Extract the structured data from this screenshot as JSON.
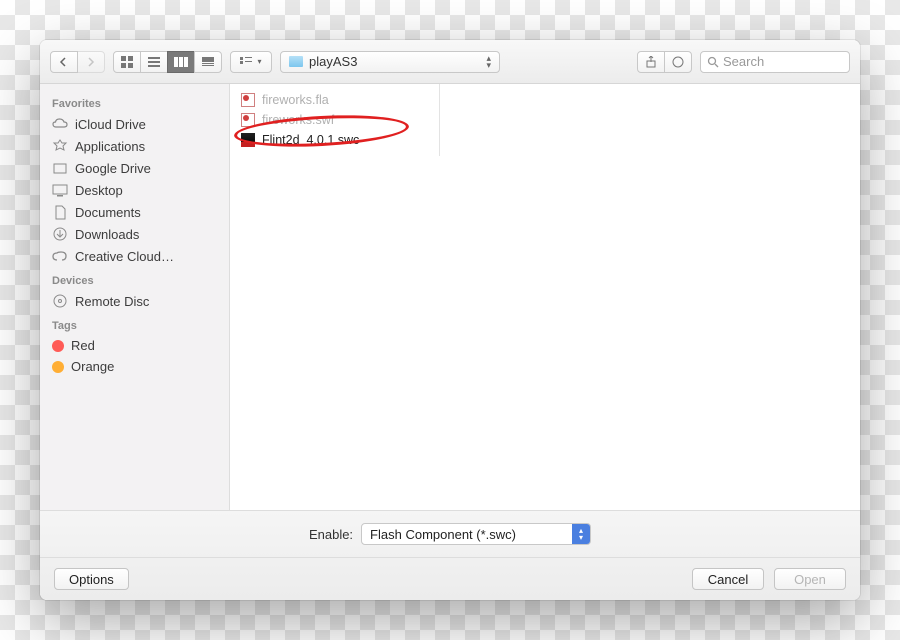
{
  "toolbar": {
    "path_label": "playAS3",
    "search_placeholder": "Search"
  },
  "sidebar": {
    "sections": [
      {
        "header": "Favorites",
        "items": [
          {
            "label": "iCloud Drive",
            "icon": "cloud-icon"
          },
          {
            "label": "Applications",
            "icon": "apps-icon"
          },
          {
            "label": "Google Drive",
            "icon": "drive-icon"
          },
          {
            "label": "Desktop",
            "icon": "desktop-icon"
          },
          {
            "label": "Documents",
            "icon": "documents-icon"
          },
          {
            "label": "Downloads",
            "icon": "downloads-icon"
          },
          {
            "label": "Creative Cloud…",
            "icon": "creative-cloud-icon"
          }
        ]
      },
      {
        "header": "Devices",
        "items": [
          {
            "label": "Remote Disc",
            "icon": "disc-icon"
          }
        ]
      },
      {
        "header": "Tags",
        "items": [
          {
            "label": "Red",
            "color": "#ff5b56"
          },
          {
            "label": "Orange",
            "color": "#ffae34"
          }
        ]
      }
    ]
  },
  "files": [
    {
      "name": "fireworks.fla",
      "kind": "fla",
      "disabled": true
    },
    {
      "name": "fireworks.swf",
      "kind": "swf",
      "disabled": true
    },
    {
      "name": "Flint2d_4.0.1.swc",
      "kind": "swc",
      "disabled": false,
      "highlighted": true
    }
  ],
  "enable": {
    "label": "Enable:",
    "value": "Flash Component (*.swc)"
  },
  "buttons": {
    "options": "Options",
    "cancel": "Cancel",
    "open": "Open"
  }
}
